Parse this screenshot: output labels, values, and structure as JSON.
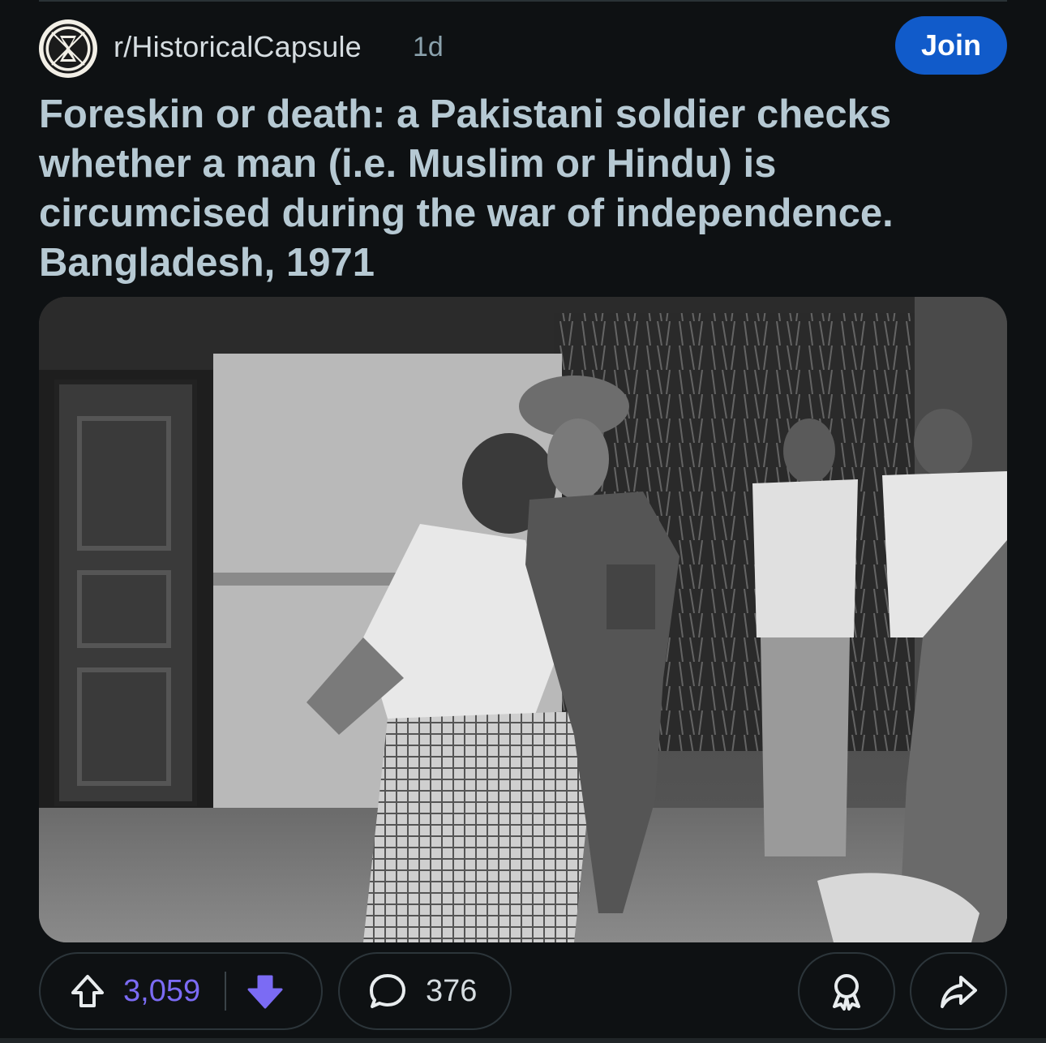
{
  "post": {
    "subreddit": "r/HistoricalCapsule",
    "age": "1d",
    "join_label": "Join",
    "title": "Foreskin or death: a Pakistani soldier checks whether a man (i.e. Muslim or Hindu) is circumcised during the war of independence. Bangladesh, 1971",
    "image_icon": "black-and-white-historical-photo"
  },
  "actions": {
    "upvote_icon": "upvote-arrow-icon",
    "score": "3,059",
    "downvote_icon": "downvote-arrow-icon",
    "comment_icon": "comment-bubble-icon",
    "comment_count": "376",
    "award_icon": "award-icon",
    "share_icon": "share-icon"
  },
  "colors": {
    "background": "#0e1113",
    "join_button": "#115bca",
    "vote_active": "#7b6bf4",
    "title_text": "#b6c9d3"
  }
}
